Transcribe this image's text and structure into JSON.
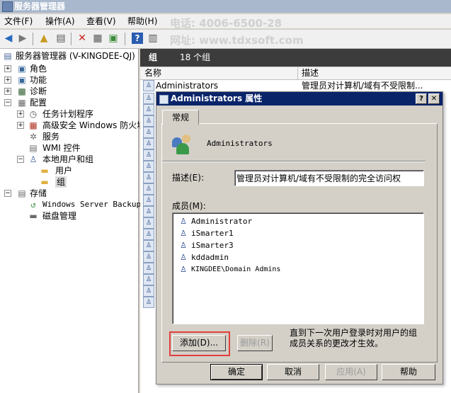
{
  "app": {
    "title": "服务器管理器"
  },
  "menu": [
    "文件(F)",
    "操作(A)",
    "查看(V)",
    "帮助(H)"
  ],
  "toolbar": {
    "icons": [
      "back-icon",
      "forward-icon",
      "up-folder-icon",
      "show-hide-tree-icon",
      "delete-icon",
      "properties-icon",
      "export-icon",
      "help-icon",
      "show-action-pane-icon"
    ]
  },
  "tree": {
    "root": "服务器管理器 (V-KINGDEE-QJ)",
    "items": [
      "角色",
      "功能",
      "诊断",
      "配置",
      "任务计划程序",
      "高级安全 Windows 防火墙",
      "服务",
      "WMI 控件",
      "本地用户和组",
      "用户",
      "组",
      "存储",
      "Windows Server Backup",
      "磁盘管理"
    ]
  },
  "right": {
    "header_title": "组",
    "header_count": "18 个组",
    "columns": [
      "名称",
      "描述"
    ],
    "first_row": {
      "name": "Administrators",
      "desc": "管理员对计算机/域有不受限制..."
    }
  },
  "dialog": {
    "title": "Administrators 属性",
    "help_btn": "?",
    "close_btn": "✕",
    "tab": "常规",
    "group_name": "Administrators",
    "desc_label": "描述(E):",
    "desc_value": "管理员对计算机/域有不受限制的完全访问权",
    "members_label": "成员(M):",
    "members": [
      "Administrator",
      "iSmarter1",
      "iSmarter3",
      "kddadmin",
      "KINGDEE\\Domain Admins"
    ],
    "add_btn": "添加(D)...",
    "remove_btn": "删除(R)",
    "note": "直到下一次用户登录时对用户的组成员关系的更改才生效。",
    "ok_btn": "确定",
    "cancel_btn": "取消",
    "apply_btn": "应用(A)",
    "help_bottom_btn": "帮助"
  },
  "watermark": {
    "phone": "电话: 4006-6500-28",
    "site": "网址: www.tdxsoft.com"
  },
  "colors": {
    "highlight_red": "#e0403c",
    "title_blue": "#0a246a",
    "right_header": "#3c3c3c"
  }
}
